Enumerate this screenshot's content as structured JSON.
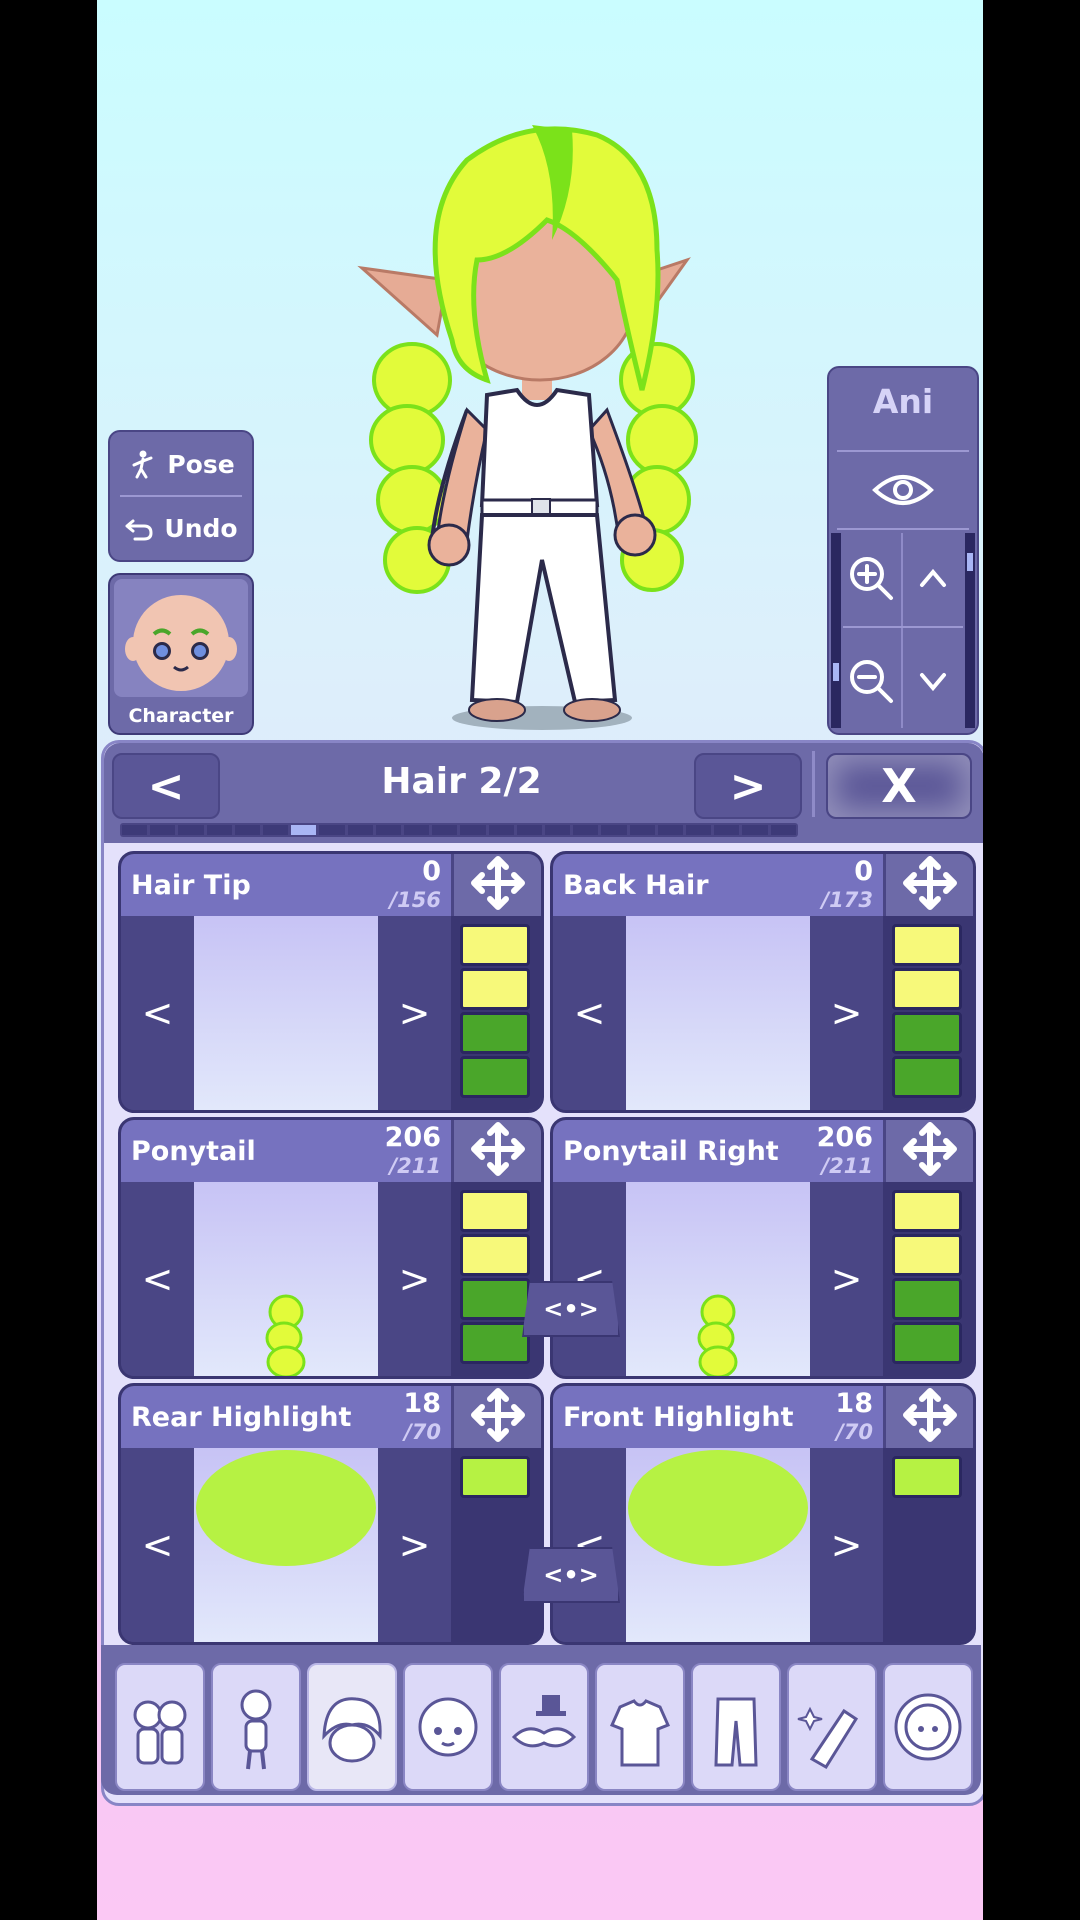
{
  "side": {
    "pose_label": "Pose",
    "undo_label": "Undo",
    "character_label": "Character"
  },
  "view_panel": {
    "ani_label": "Ani"
  },
  "editor": {
    "title": "Hair 2/2",
    "prev_label": "<",
    "next_label": ">",
    "close_label": "X",
    "page_progress": {
      "current_segment": 6,
      "segments": 24
    }
  },
  "cards": [
    {
      "title": "Hair Tip",
      "value": "0",
      "total": "/156",
      "swatches": [
        "#f7f97a",
        "#f7f97a",
        "#4aa62a",
        "#4aa62a"
      ]
    },
    {
      "title": "Back Hair",
      "value": "0",
      "total": "/173",
      "swatches": [
        "#f7f97a",
        "#f7f97a",
        "#4aa62a",
        "#4aa62a"
      ]
    },
    {
      "title": "Ponytail",
      "value": "206",
      "total": "/211",
      "swatches": [
        "#f7f97a",
        "#f7f97a",
        "#4aa62a",
        "#4aa62a"
      ]
    },
    {
      "title": "Ponytail Right",
      "value": "206",
      "total": "/211",
      "swatches": [
        "#f7f97a",
        "#f7f97a",
        "#4aa62a",
        "#4aa62a"
      ]
    },
    {
      "title": "Rear Highlight",
      "value": "18",
      "total": "/70",
      "swatches": [
        "#b6f243"
      ]
    },
    {
      "title": "Front Highlight",
      "value": "18",
      "total": "/70",
      "swatches": [
        "#b6f243"
      ]
    }
  ],
  "arrows": {
    "left": "<",
    "right": ">"
  },
  "link_label": "<•>",
  "categories": [
    {
      "name": "characters-icon"
    },
    {
      "name": "body-icon"
    },
    {
      "name": "hair-icon",
      "active": true
    },
    {
      "name": "face-icon"
    },
    {
      "name": "accessories-icon"
    },
    {
      "name": "top-icon"
    },
    {
      "name": "bottom-icon"
    },
    {
      "name": "props-icon"
    },
    {
      "name": "profile-icon"
    }
  ],
  "colors": {
    "hair": "#e2fb3a",
    "hair_accent": "#7be21a",
    "skin": "#eab29b",
    "panel": "#6d6aa8"
  }
}
